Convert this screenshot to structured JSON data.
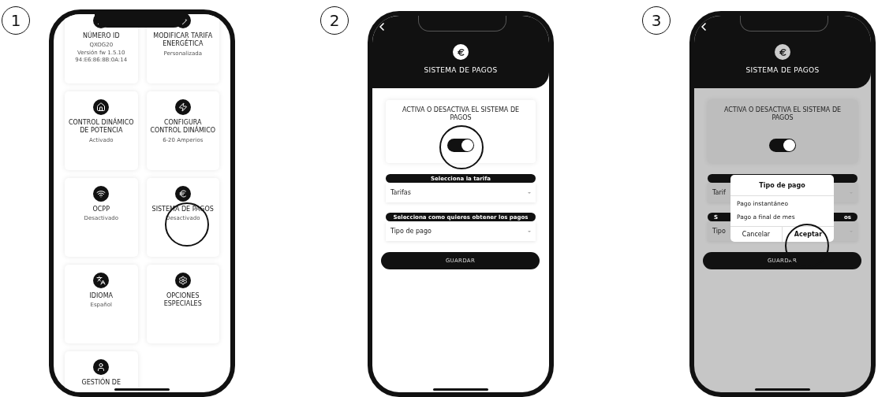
{
  "step_1": {
    "number": "1",
    "cards": [
      {
        "title": "NÚMERO ID",
        "details": [
          "QXOG20",
          "Versión fw 1.5.10",
          "94:E6:86:8B:0A:14"
        ]
      },
      {
        "title": "MODIFICAR TARIFA ENERGÉTICA",
        "details": [
          "Personalizada"
        ]
      },
      {
        "title": "CONTROL DINÁMICO DE POTENCIA",
        "details": [
          "Activado"
        ]
      },
      {
        "title": "CONFIGURA CONTROL DINÁMICO",
        "details": [
          "6-20 Amperios"
        ]
      },
      {
        "title": "OCPP",
        "details": [
          "Desactivado"
        ]
      },
      {
        "title": "SISTEMA DE PAGOS",
        "details": [
          "Desactivado"
        ]
      },
      {
        "title": "IDIOMA",
        "details": [
          "Español"
        ]
      },
      {
        "title": "OPCIONES ESPECIALES"
      },
      {
        "title": "GESTIÓN DE"
      }
    ]
  },
  "step_2": {
    "number": "2",
    "title": "SISTEMA DE PAGOS",
    "toggle_card": {
      "title": "ACTIVA O DESACTIVA EL SISTEMA DE PAGOS",
      "on": true
    },
    "fields": [
      {
        "label_parts": [
          "Selecciona la tarifa"
        ],
        "value": "Tarifas"
      },
      {
        "label_parts": [
          "Selecciona como quieres obtener los pagos"
        ],
        "value": "Tipo de pago"
      }
    ],
    "button": "GUARDAR"
  },
  "step_3": {
    "number": "3",
    "title": "SISTEMA DE PAGOS",
    "toggle_card": {
      "title": "ACTIVA O DESACTIVA EL SISTEMA DE PAGOS",
      "on": true
    },
    "fields": [
      {
        "value": "Tarif"
      },
      {
        "label_parts": [
          "S",
          "os"
        ],
        "value": "Tipo"
      }
    ],
    "button": "GUARDAR",
    "dialog": {
      "title": "Tipo de pago",
      "options": [
        "Pago instantáneo",
        "Pago a final de mes"
      ],
      "cancel": "Cancelar",
      "accept": "Aceptar"
    }
  }
}
